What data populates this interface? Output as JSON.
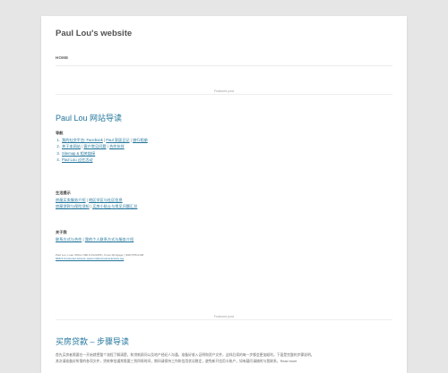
{
  "site": {
    "title": "Paul Lou's website"
  },
  "nav": {
    "home_label": "HOME"
  },
  "post1": {
    "featured_label": "Featured post",
    "title": "Paul Lou 网站导读",
    "guide": {
      "heading": "导航",
      "items": [
        [
          "我的社交平台: Facebook",
          "Paul 家居日记",
          "旅行相册"
        ],
        [
          "关于本网站",
          "客户常见问题",
          "合作伙伴"
        ],
        [
          "Sitemap & 相关链接"
        ],
        [
          "Paul Lou 过往活动"
        ]
      ]
    },
    "services": {
      "heading": "生活提示",
      "lines": [
        [
          "房屋买卖服务介绍",
          "地区学区与社区信息"
        ],
        [
          "房屋贷款与保险须知",
          "买房小贴士与常见问题汇总"
        ]
      ]
    },
    "about": {
      "heading": "关于我",
      "lines": [
        [
          "联系方式与合作",
          "我的个人联系方式与服务介绍"
        ]
      ]
    },
    "contact_line1": "Paul Lou, Loan Officer NMLS #123456 | Cross Mortgage | (949) 555-0148",
    "contact_line2": "NMLS Consumer Access: www.nmlsconsumeraccess.org"
  },
  "post2": {
    "featured_label": "Featured post",
    "title": "买房贷款 – 步骤导读",
    "excerpt_line1": "首先买房者需要在一开始就把整个流程了解清楚，和贷款顾问以及地产经纪人沟通，准备好收入证明和资产文件，这样后续的每一步都会更加顺利，下面是完整的步骤说明。",
    "excerpt_line2": "其次请准备好所需的各项文件，贷款审批通常需要三到四周时间，期间请保持工作和信用状况稳定，避免新开信用卡账户，如有疑问请随时与我联系，Read more"
  }
}
